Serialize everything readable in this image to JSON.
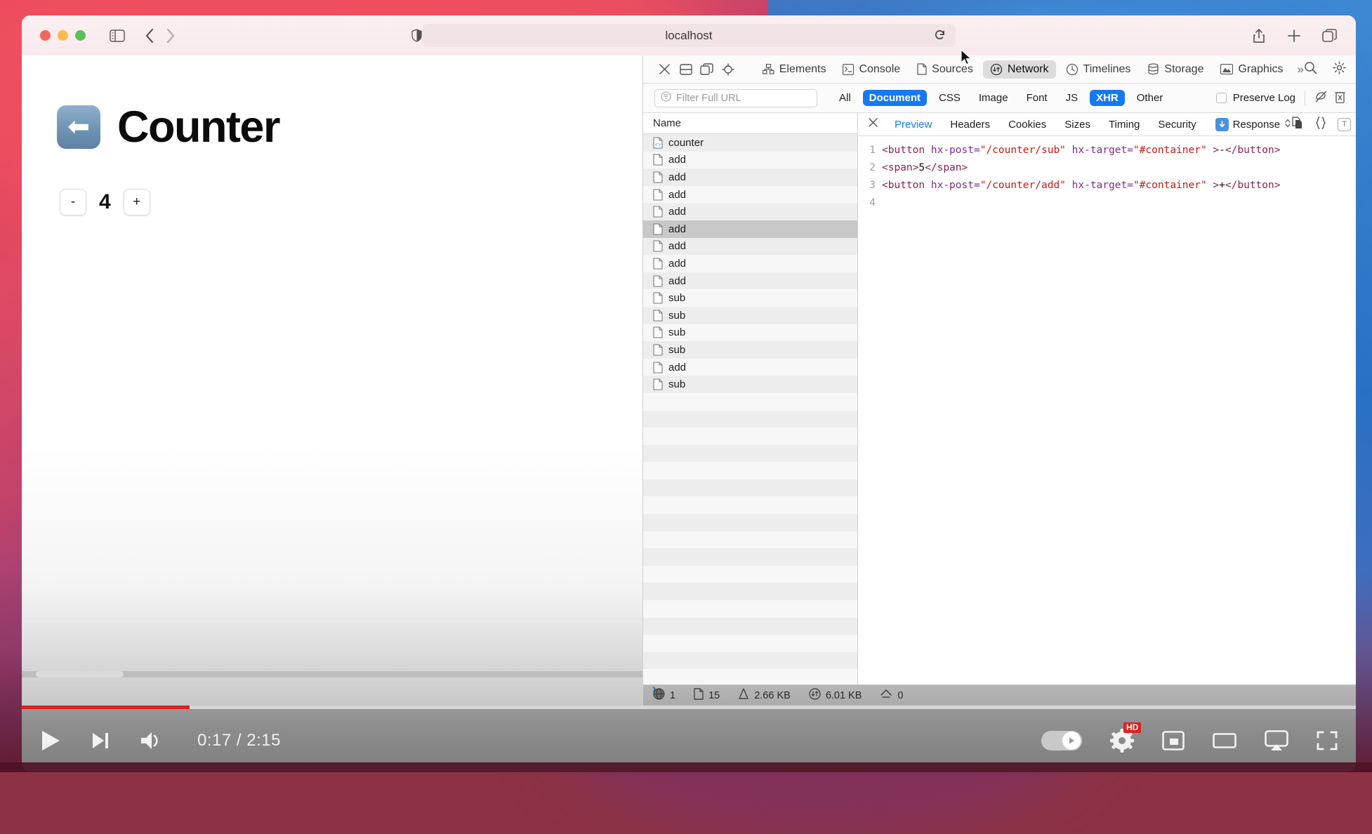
{
  "browser": {
    "url": "localhost",
    "traffic_lights": [
      "close",
      "minimize",
      "zoom"
    ],
    "icons": {
      "sidebar": "sidebar-icon",
      "back": "back-chevron-icon",
      "forward": "forward-chevron-icon",
      "shield": "privacy-shield-icon",
      "reload": "reload-icon",
      "share": "share-icon",
      "new_tab": "plus-icon",
      "tab_overview": "tab-overview-icon"
    }
  },
  "page": {
    "back_emoji": "⬅",
    "title": "Counter",
    "decrement_label": "-",
    "value": "4",
    "increment_label": "+"
  },
  "inspector": {
    "controls": [
      "close-inspector",
      "dock-bottom",
      "dock-side",
      "inspect-element"
    ],
    "tabs": [
      {
        "label": "Elements",
        "icon": "elements-icon",
        "active": false
      },
      {
        "label": "Console",
        "icon": "console-icon",
        "active": false
      },
      {
        "label": "Sources",
        "icon": "sources-icon",
        "active": false
      },
      {
        "label": "Network",
        "icon": "network-icon",
        "active": true
      },
      {
        "label": "Timelines",
        "icon": "timelines-icon",
        "active": false
      },
      {
        "label": "Storage",
        "icon": "storage-icon",
        "active": false
      },
      {
        "label": "Graphics",
        "icon": "graphics-icon",
        "active": false
      }
    ],
    "more_tabs": "»",
    "right_icons": [
      "search-icon",
      "gear-icon"
    ],
    "filter": {
      "placeholder": "Filter Full URL",
      "value": "",
      "types": [
        {
          "label": "All",
          "on": false
        },
        {
          "label": "Document",
          "on": true
        },
        {
          "label": "CSS",
          "on": false
        },
        {
          "label": "Image",
          "on": false
        },
        {
          "label": "Font",
          "on": false
        },
        {
          "label": "JS",
          "on": false
        },
        {
          "label": "XHR",
          "on": true
        },
        {
          "label": "Other",
          "on": false
        }
      ],
      "preserve_log_label": "Preserve Log",
      "preserve_log_checked": false,
      "actions": [
        "clear-network-items-icon",
        "trash-icon"
      ]
    },
    "network_list": {
      "column_header": "Name",
      "rows": [
        {
          "name": "counter",
          "icon": "document-code-icon",
          "selected": false
        },
        {
          "name": "add",
          "icon": "document-icon",
          "selected": false
        },
        {
          "name": "add",
          "icon": "document-icon",
          "selected": false
        },
        {
          "name": "add",
          "icon": "document-icon",
          "selected": false
        },
        {
          "name": "add",
          "icon": "document-icon",
          "selected": false
        },
        {
          "name": "add",
          "icon": "document-icon",
          "selected": true
        },
        {
          "name": "add",
          "icon": "document-icon",
          "selected": false
        },
        {
          "name": "add",
          "icon": "document-icon",
          "selected": false
        },
        {
          "name": "add",
          "icon": "document-icon",
          "selected": false
        },
        {
          "name": "sub",
          "icon": "document-icon",
          "selected": false
        },
        {
          "name": "sub",
          "icon": "document-icon",
          "selected": false
        },
        {
          "name": "sub",
          "icon": "document-icon",
          "selected": false
        },
        {
          "name": "sub",
          "icon": "document-icon",
          "selected": false
        },
        {
          "name": "add",
          "icon": "document-icon",
          "selected": false
        },
        {
          "name": "sub",
          "icon": "document-icon",
          "selected": false
        }
      ]
    },
    "detail": {
      "close_label": "✕",
      "tabs": [
        {
          "label": "Preview",
          "active": true
        },
        {
          "label": "Headers",
          "active": false
        },
        {
          "label": "Cookies",
          "active": false
        },
        {
          "label": "Sizes",
          "active": false
        },
        {
          "label": "Timing",
          "active": false
        },
        {
          "label": "Security",
          "active": false
        }
      ],
      "response_selector": "Response",
      "right_icons": [
        "copy-icon",
        "format-braces-icon",
        "text-mode-icon",
        "code-mode-icon"
      ],
      "code_lines": [
        {
          "n": "1",
          "parts": [
            {
              "t": "<button ",
              "c": "tag"
            },
            {
              "t": "hx-post=",
              "c": "attr"
            },
            {
              "t": "\"/counter/sub\"",
              "c": "str"
            },
            {
              "t": " hx-target=",
              "c": "attr"
            },
            {
              "t": "\"#container\"",
              "c": "str"
            },
            {
              "t": " >",
              "c": "tag"
            },
            {
              "t": "-",
              "c": "txt"
            },
            {
              "t": "</button>",
              "c": "tag"
            }
          ]
        },
        {
          "n": "2",
          "parts": [
            {
              "t": "<span>",
              "c": "tag"
            },
            {
              "t": "5",
              "c": "txt"
            },
            {
              "t": "</span>",
              "c": "tag"
            }
          ]
        },
        {
          "n": "3",
          "parts": [
            {
              "t": "<button ",
              "c": "tag"
            },
            {
              "t": "hx-post=",
              "c": "attr"
            },
            {
              "t": "\"/counter/add\"",
              "c": "str"
            },
            {
              "t": " hx-target=",
              "c": "attr"
            },
            {
              "t": "\"#container\"",
              "c": "str"
            },
            {
              "t": " >",
              "c": "tag"
            },
            {
              "t": "+",
              "c": "txt"
            },
            {
              "t": "</button>",
              "c": "tag"
            }
          ]
        },
        {
          "n": "4",
          "parts": []
        }
      ]
    },
    "status_bar": [
      {
        "icon": "globe-icon",
        "value": "1"
      },
      {
        "icon": "document-icon",
        "value": "15"
      },
      {
        "icon": "download-size-icon",
        "value": "2.66 KB"
      },
      {
        "icon": "transfer-size-icon",
        "value": "6.01 KB"
      },
      {
        "icon": "upload-icon",
        "value": "0"
      }
    ],
    "console_prompt": "›"
  },
  "player": {
    "current_time": "0:17",
    "total_time": "2:15",
    "time_display": "0:17 / 2:15",
    "progress_percent": 12.6,
    "progress_color": "#e02020",
    "controls": [
      {
        "name": "play-button",
        "icon": "play-icon"
      },
      {
        "name": "next-button",
        "icon": "next-icon"
      },
      {
        "name": "volume-button",
        "icon": "volume-icon"
      }
    ],
    "right_controls": [
      {
        "name": "autoplay-toggle",
        "icon": "autoplay-icon"
      },
      {
        "name": "settings-button",
        "icon": "gear-icon",
        "badge": "HD"
      },
      {
        "name": "miniplayer-button",
        "icon": "miniplayer-icon"
      },
      {
        "name": "theater-button",
        "icon": "theater-icon"
      },
      {
        "name": "airplay-button",
        "icon": "airplay-icon"
      },
      {
        "name": "fullscreen-button",
        "icon": "fullscreen-icon"
      }
    ]
  },
  "colors": {
    "accent_blue": "#1579f2",
    "link_blue": "#1579f2",
    "progress_red": "#e02020",
    "hd_badge_red": "#e02020",
    "selected_row": "#c8c8c8"
  }
}
